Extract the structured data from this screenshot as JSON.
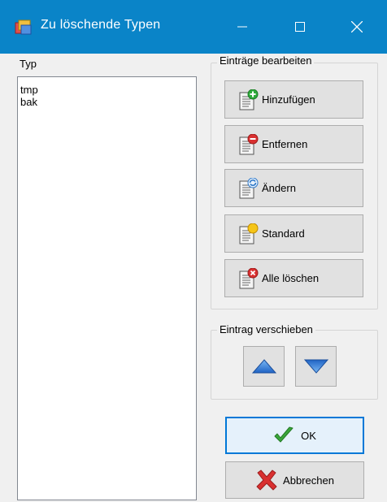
{
  "window": {
    "title": "Zu löschende Typen",
    "controls": {
      "minimize": "minimize",
      "maximize": "maximize",
      "close": "close"
    }
  },
  "types": {
    "label": "Typ",
    "items": [
      "tmp",
      "bak"
    ]
  },
  "edit_group": {
    "title": "Einträge bearbeiten",
    "buttons": {
      "add": "Hinzufügen",
      "remove": "Entfernen",
      "change": "Ändern",
      "standard": "Standard",
      "clear_all": "Alle löschen"
    }
  },
  "move_group": {
    "title": "Eintrag verschieben"
  },
  "dialog": {
    "ok": "OK",
    "cancel": "Abbrechen"
  },
  "colors": {
    "titlebar": "#0a84c8",
    "ok_border": "#0078d7",
    "arrow_blue": "#3a7fd5",
    "check_green": "#3aa63a",
    "cross_red": "#d93030"
  },
  "icons": {
    "title": "window-app-icon",
    "add": "document-add-icon",
    "remove": "document-remove-icon",
    "change": "document-refresh-icon",
    "standard": "document-star-icon",
    "clear_all": "document-delete-icon",
    "up": "arrow-up-icon",
    "down": "arrow-down-icon",
    "ok": "checkmark-icon",
    "cancel": "cross-icon"
  }
}
